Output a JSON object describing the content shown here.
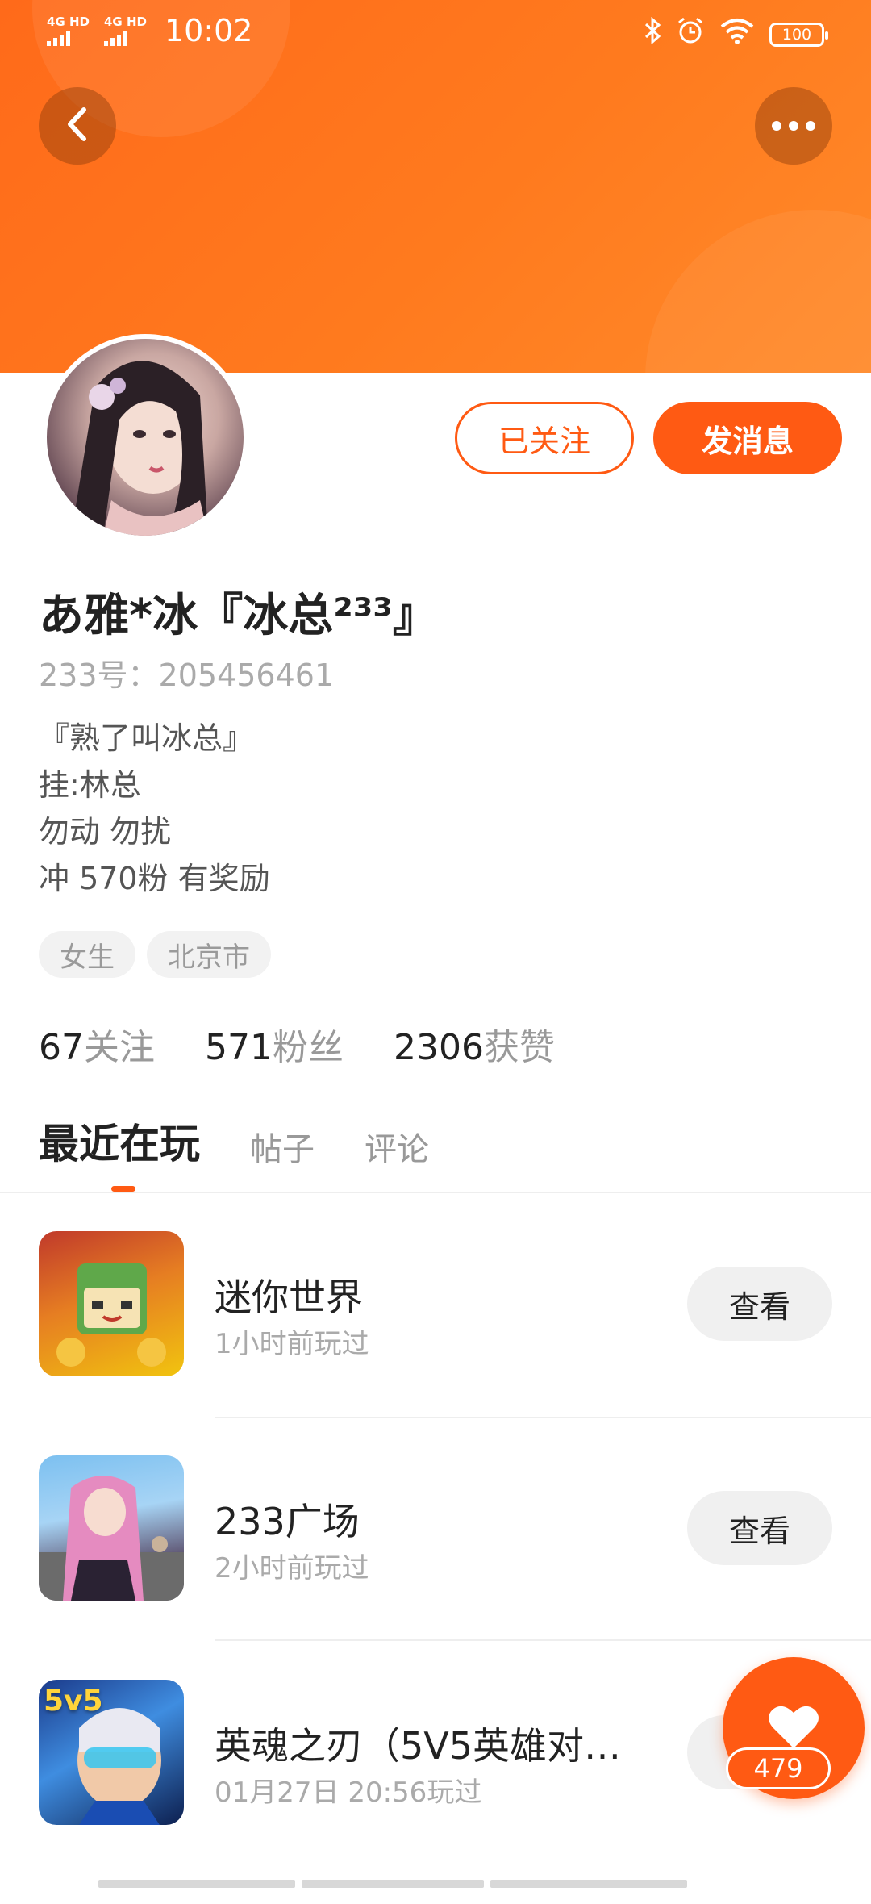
{
  "status_bar": {
    "signal_1": "4G HD",
    "signal_2": "4G HD",
    "time": "10:02",
    "battery": "100",
    "icons": [
      "bluetooth-icon",
      "alarm-icon",
      "wifi-icon",
      "battery-icon"
    ]
  },
  "header": {
    "back_icon": "chevron-left-icon",
    "more_icon": "more-dots-icon"
  },
  "actions": {
    "follow_label": "已关注",
    "message_label": "发消息"
  },
  "profile": {
    "name": "あ雅*冰『冰总²³³』",
    "id_line": "233号：205456461",
    "bio": [
      "『熟了叫冰总』",
      "挂:林总",
      "勿动 勿扰",
      "冲 570粉 有奖励"
    ],
    "tags": [
      "女生",
      "北京市"
    ]
  },
  "stats": [
    {
      "value": "67",
      "label": "关注"
    },
    {
      "value": "571",
      "label": "粉丝"
    },
    {
      "value": "2306",
      "label": "获赞"
    }
  ],
  "tabs": [
    "最近在玩",
    "帖子",
    "评论"
  ],
  "games": [
    {
      "title": "迷你世界",
      "time": "1小时前玩过",
      "button": "查看"
    },
    {
      "title": "233广场",
      "time": "2小时前玩过",
      "button": "查看"
    },
    {
      "title": "英魂之刃（5V5英雄对…",
      "time": "01月27日 20:56玩过",
      "button": "查看",
      "icon_text": "5v5"
    }
  ],
  "like": {
    "count": "479"
  },
  "colors": {
    "accent": "#ff5a13",
    "banner": "#ff7a1e"
  }
}
